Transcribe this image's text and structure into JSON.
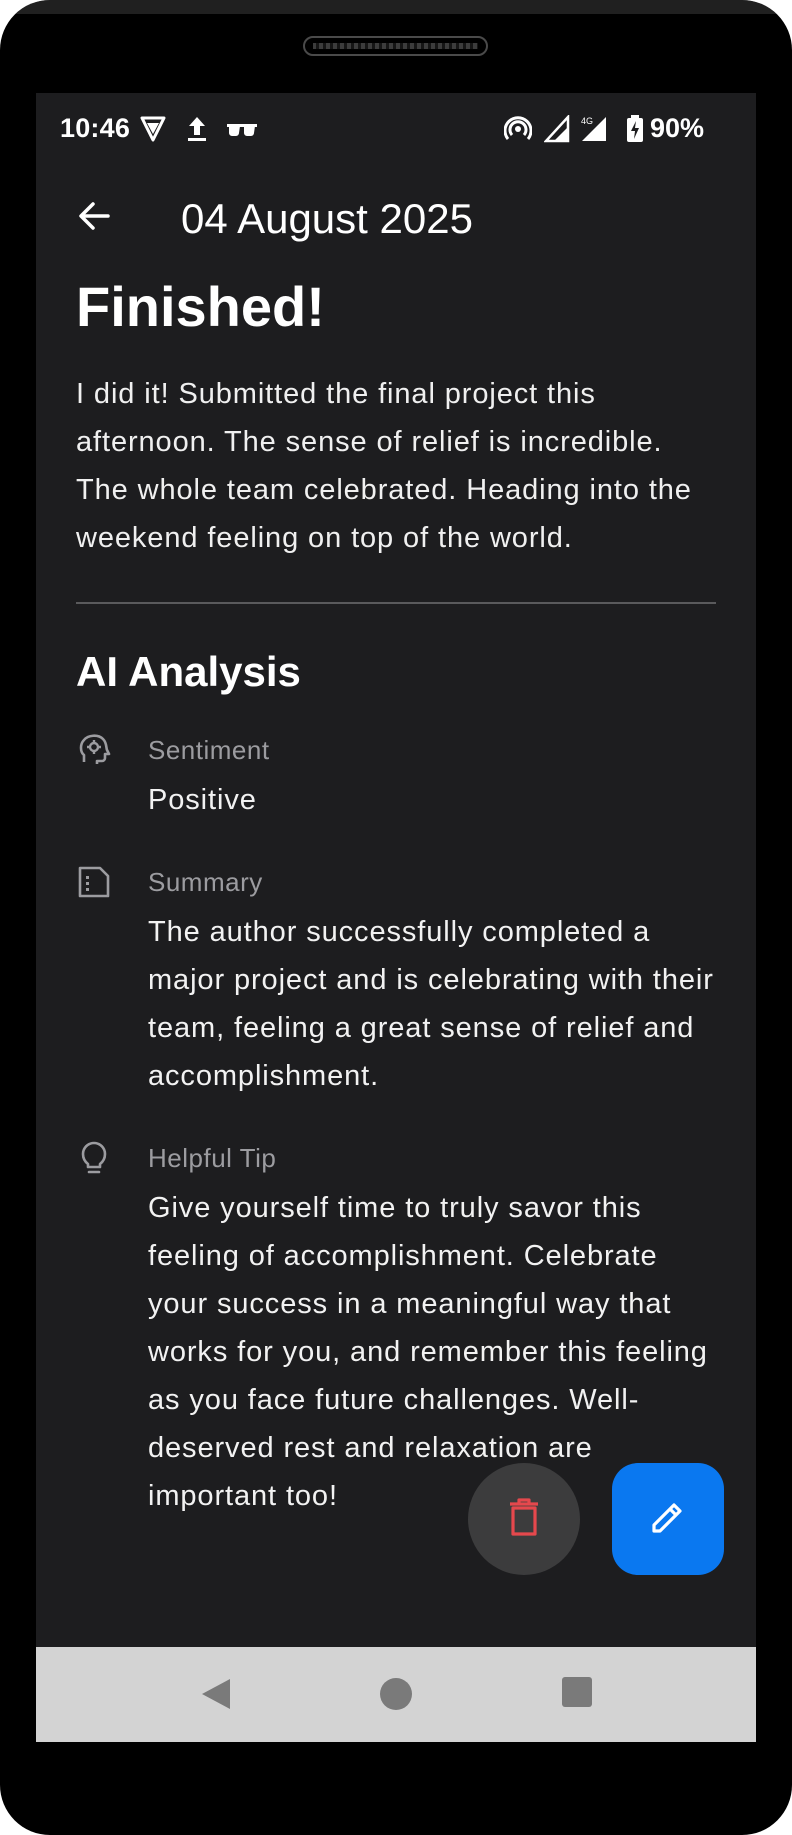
{
  "status_bar": {
    "time": "10:46",
    "battery": "90%",
    "icons": [
      "vpn-shield-icon",
      "upload-icon",
      "incognito-glasses-icon",
      "hotspot-icon",
      "signal-icon",
      "lte-signal-icon",
      "battery-charging-icon"
    ]
  },
  "app_bar": {
    "title": "04 August 2025",
    "back_icon": "arrow-left-icon"
  },
  "entry": {
    "title": "Finished!",
    "body": "I did it! Submitted the final project this afternoon. The sense of relief is incredible. The whole team celebrated. Heading into the weekend feeling on top of the world."
  },
  "ai_analysis": {
    "heading": "AI Analysis",
    "items": [
      {
        "icon": "psychology-head-icon",
        "label": "Sentiment",
        "value": "Positive"
      },
      {
        "icon": "summary-document-icon",
        "label": "Summary",
        "value": "The author successfully completed a major project and is celebrating with their team, feeling a great sense of relief and accomplishment."
      },
      {
        "icon": "lightbulb-icon",
        "label": "Helpful Tip",
        "value": "Give yourself time to truly savor this feeling of accomplishment. Celebrate your success in a meaningful way that works for you, and remember this feeling as you face future challenges.  Well-deserved rest and relaxation are important too!"
      }
    ]
  },
  "fabs": {
    "delete_icon": "trash-icon",
    "edit_icon": "pencil-icon",
    "delete_color": "#e5484d",
    "edit_color": "#0a78f0"
  },
  "nav_bar": {
    "icons": [
      "nav-back-icon",
      "nav-home-icon",
      "nav-recents-icon"
    ]
  }
}
